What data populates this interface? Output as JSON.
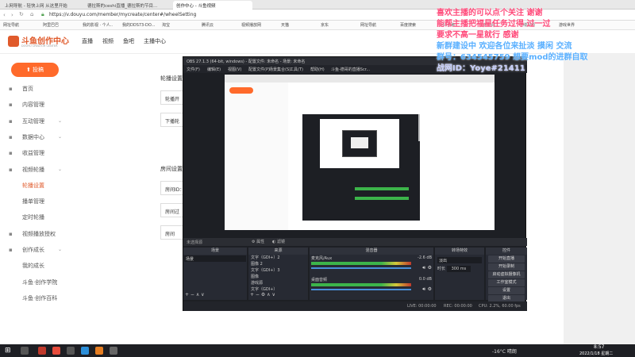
{
  "browser": {
    "tabs": [
      {
        "label": "上网导航 - 轻快上网 从这里开始",
        "active": false
      },
      {
        "label": "德拉斯的ceshi直播_德拉斯的节目...",
        "active": false
      },
      {
        "label": "创作中心 - 斗鱼视频",
        "active": true
      }
    ],
    "url": "https://v.douyu.com/member/mycreate/center#/wheelSetting",
    "bookmarks": [
      "网址导航",
      "阿里巴巴",
      "我的影视 · 个人..",
      "我的DDS73-DO...",
      "淘宝",
      "腾讯云",
      "视频播放网",
      "天猫",
      "京东",
      "网址导航",
      "百度搜索",
      "360搜索",
      "头条新闻",
      "在线视频",
      "游戏世界"
    ]
  },
  "site": {
    "logo": "斗鱼创作中心",
    "logo_sub": "DOUYU CREATOR CENTER",
    "topnav": [
      "直播",
      "视频",
      "鱼吧",
      "主播中心"
    ],
    "upload_button": "投稿",
    "nav": [
      {
        "label": "首页",
        "icon": "home-icon",
        "indent": false,
        "expand": false
      },
      {
        "label": "内容管理",
        "icon": "content-icon",
        "indent": false,
        "expand": false
      },
      {
        "label": "互动管理",
        "icon": "chat-icon",
        "indent": false,
        "expand": true
      },
      {
        "label": "数据中心",
        "icon": "data-icon",
        "indent": false,
        "expand": true
      },
      {
        "label": "收益管理",
        "icon": "income-icon",
        "indent": false,
        "expand": false
      },
      {
        "label": "视频轮播",
        "icon": "carousel-icon",
        "indent": false,
        "expand": true
      },
      {
        "label": "轮播设置",
        "icon": "",
        "indent": true,
        "active": true
      },
      {
        "label": "播单管理",
        "icon": "",
        "indent": true
      },
      {
        "label": "定时轮播",
        "icon": "",
        "indent": true
      },
      {
        "label": "视频播放授权",
        "icon": "auth-icon",
        "indent": false,
        "expand": false
      },
      {
        "label": "创作成长",
        "icon": "growth-icon",
        "indent": false,
        "expand": true
      },
      {
        "label": "我的成长",
        "icon": "",
        "indent": true
      },
      {
        "label": "斗鱼·创作学院",
        "icon": "",
        "indent": true
      },
      {
        "label": "斗鱼·创作百科",
        "icon": "",
        "indent": true
      }
    ],
    "content": {
      "section1": "轮播设置",
      "opt1": "轮播开",
      "opt2": "下播轮",
      "section2": "房间设置",
      "room1": "房间ID：",
      "room2": "房间过",
      "room3": "房间"
    }
  },
  "obs": {
    "title": "OBS 27.1.3 (64-bit, windows) - 配置文件: 未命名 - 场景: 未命名",
    "menu": [
      "文件(F)",
      "编辑(E)",
      "视图(V)",
      "配置文件(P)",
      "场景集合(S)",
      "工具(T)",
      "帮助(H)",
      "斗鱼-德哥的直播Scr..."
    ],
    "source_bar": {
      "attr": "属性",
      "filter": "滤镜"
    },
    "dock_titles": [
      "场景",
      "来源",
      "混音器",
      "转场特效",
      "控件"
    ],
    "scene": "场景",
    "sources": [
      "文字（GDI+）2",
      "图像 2",
      "文字（GDI+）3",
      "图像",
      "游戏源",
      "文字（GDI+）"
    ],
    "mixer": [
      {
        "name": "麦克风/Aux",
        "db": "-2.6 dB"
      },
      {
        "name": "桌面音频",
        "db": "0.0 dB"
      }
    ],
    "transition": {
      "type": "淡出",
      "duration_label": "时长",
      "duration": "300 ms"
    },
    "controls": [
      "开始直播",
      "开始录制",
      "启动虚拟摄像机",
      "工作室模式",
      "设置",
      "退出"
    ],
    "status": {
      "live": "LIVE: 00:00:00",
      "rec": "REC: 00:00:00",
      "cpu": "CPU: 2.2%, 60.00 fps"
    }
  },
  "overlay": {
    "lines": [
      "喜欢主播的可以点个关注 谢谢",
      "能帮主播把福星任务过得 过一过",
      "要求不高一星就行 感谢",
      "新群建设中 欢迎各位来扯淡 摸闲 交流",
      "群号：634545759 想要mod的进群自取",
      "战网ID：Yoye#21411"
    ]
  },
  "taskbar": {
    "weather": "-16°C 晴朗",
    "time": "8:57",
    "date": "2022/1/18 星期二"
  },
  "colors": {
    "accent": "#e05a2b",
    "obs_bg": "#1d1f24",
    "overlay_text": "#ff4a7a",
    "green_meter": "#3cb44a"
  }
}
